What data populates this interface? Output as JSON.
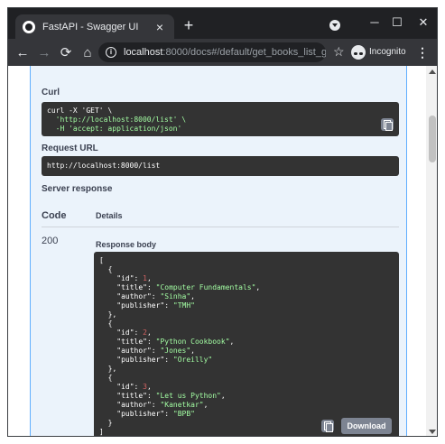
{
  "browser": {
    "tab_title": "FastAPI - Swagger UI",
    "tab_close": "×",
    "new_tab": "+",
    "window_controls": {
      "minimize": "─",
      "maximize": "☐",
      "close": "✕"
    },
    "nav": {
      "back": "←",
      "forward": "→",
      "reload": "⟳",
      "home": "⌂"
    },
    "info": "i",
    "url_host": "localhost",
    "url_path": ":8000/docs#/default/get_books_list_get",
    "star": "☆",
    "incognito_label": "Incognito",
    "menu": "⋮"
  },
  "page": {
    "curl_label": "Curl",
    "curl_lines": [
      "curl -X 'GET' \\",
      "  'http://localhost:8000/list' \\",
      "  -H 'accept: application/json'"
    ],
    "request_url_label": "Request URL",
    "request_url": "http://localhost:8000/list",
    "server_response_label": "Server response",
    "code_header": "Code",
    "details_header": "Details",
    "response_code": "200",
    "response_body_label": "Response body",
    "download_label": "Download",
    "response_body": [
      {
        "id": 1,
        "title": "Computer Fundamentals",
        "author": "Sinha",
        "publisher": "TMH"
      },
      {
        "id": 2,
        "title": "Python Cookbook",
        "author": "Jones",
        "publisher": "Oreilly"
      },
      {
        "id": 3,
        "title": "Let us Python",
        "author": "Kanetkar",
        "publisher": "BPB"
      }
    ]
  }
}
